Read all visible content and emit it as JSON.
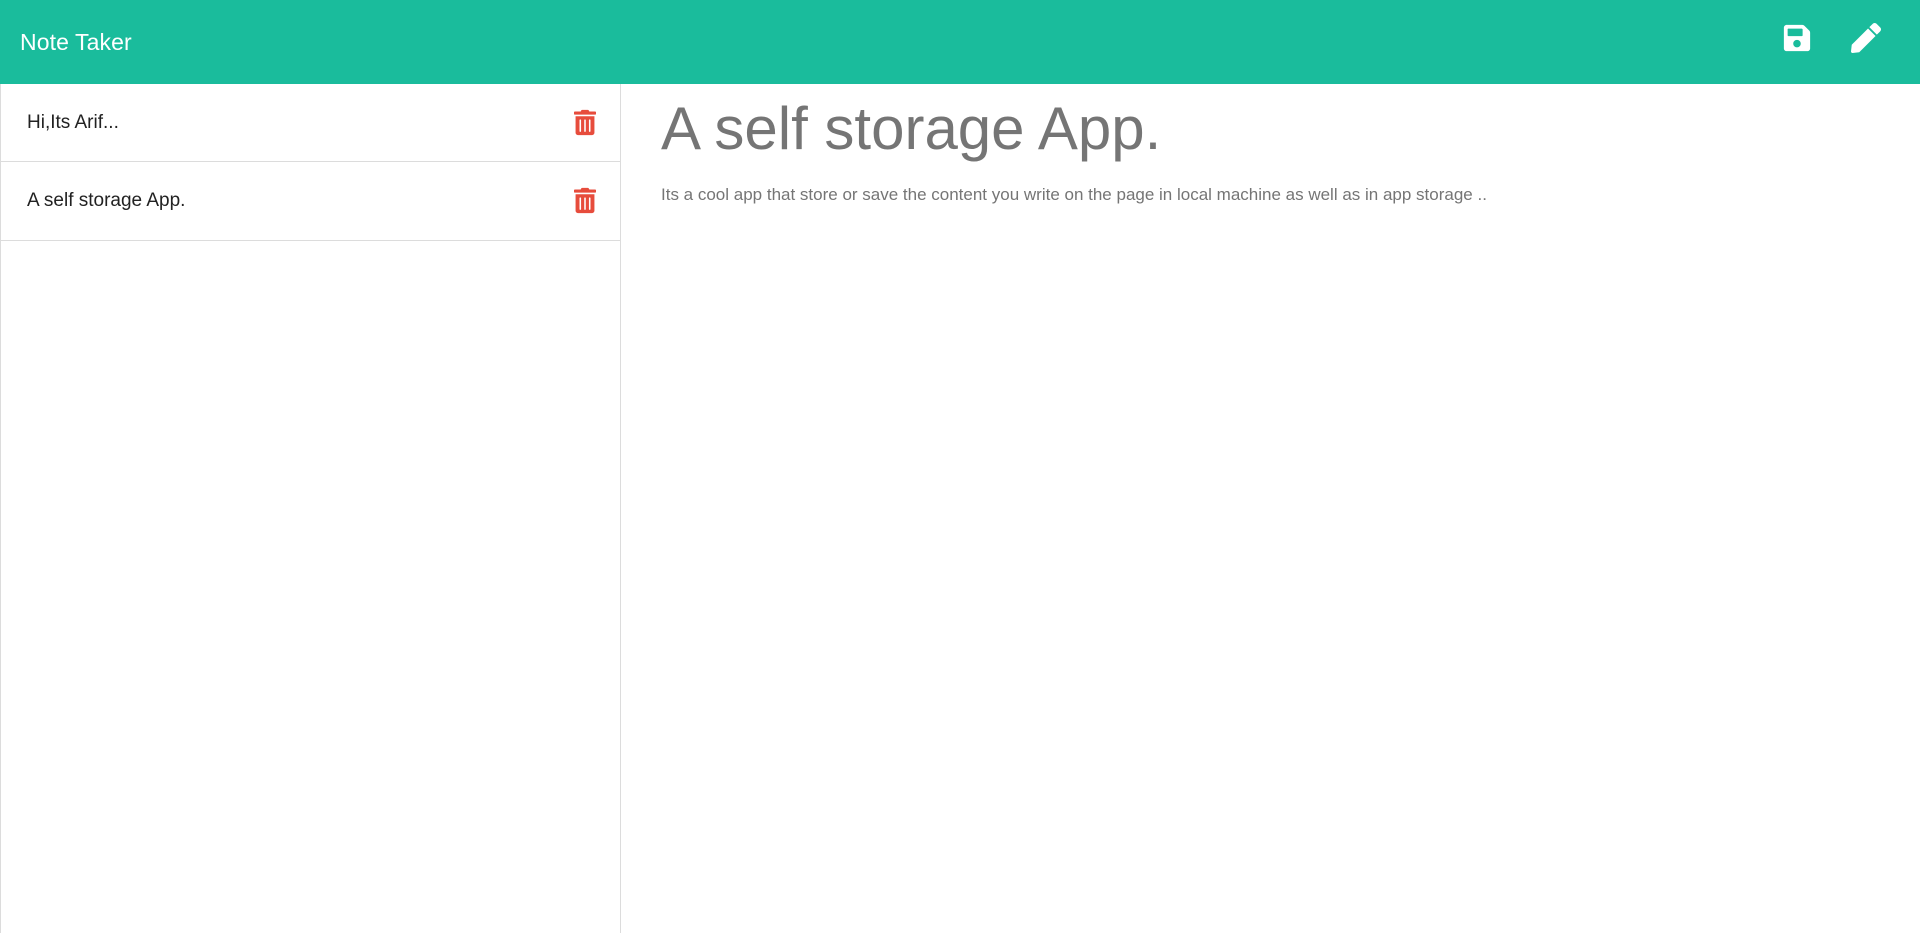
{
  "header": {
    "title": "Note Taker",
    "save_icon": "save-icon",
    "edit_icon": "pencil-icon",
    "background": "#1abc9c"
  },
  "sidebar": {
    "notes": [
      {
        "title": "Hi,Its Arif...",
        "delete_icon": "trash-icon"
      },
      {
        "title": "A self storage App.",
        "delete_icon": "trash-icon"
      }
    ],
    "delete_color": "#e74c3c"
  },
  "editor": {
    "title": "A self storage App.",
    "text": "Its a cool app that store or save the content you write on the page in local machine as well as in app storage .."
  }
}
